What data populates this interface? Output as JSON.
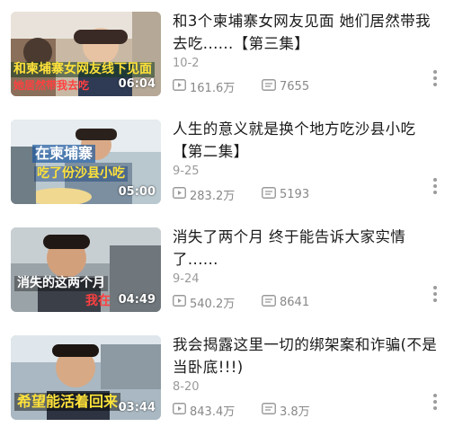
{
  "videos": [
    {
      "title": "和3个柬埔寨女网友见面 她们居然带我去吃......【第三集】",
      "date": "10-2",
      "views": "161.6万",
      "comments": "7655",
      "duration": "06:04",
      "overlay_lines": [
        "和柬埔寨女网友线下见面",
        "她居然带我去吃"
      ],
      "icons": {
        "views": "play-count-icon",
        "comments": "comment-icon",
        "more": "more-options-icon"
      }
    },
    {
      "title": "人生的意义就是换个地方吃沙县小吃【第二集】",
      "date": "9-25",
      "views": "283.2万",
      "comments": "5193",
      "duration": "05:00",
      "overlay_lines": [
        "在柬埔寨",
        "吃了份沙县小吃"
      ],
      "icons": {
        "views": "play-count-icon",
        "comments": "comment-icon",
        "more": "more-options-icon"
      }
    },
    {
      "title": "消失了两个月 终于能告诉大家实情了......",
      "date": "9-24",
      "views": "540.2万",
      "comments": "8641",
      "duration": "04:49",
      "overlay_lines": [
        "消失的这两个月",
        "我在"
      ],
      "icons": {
        "views": "play-count-icon",
        "comments": "comment-icon",
        "more": "more-options-icon"
      }
    },
    {
      "title": "我会揭露这里一切的绑架案和诈骗(不是当卧底!!!)",
      "date": "8-20",
      "views": "843.4万",
      "comments": "3.8万",
      "duration": "03:44",
      "overlay_lines": [
        "希望能活着回来"
      ],
      "icons": {
        "views": "play-count-icon",
        "comments": "comment-icon",
        "more": "more-options-icon"
      }
    }
  ],
  "colors": {
    "meta_text": "#888888",
    "title_text": "#1a1a1a",
    "overlay_yellow": "#ffe23a",
    "overlay_red": "#ff4040"
  }
}
